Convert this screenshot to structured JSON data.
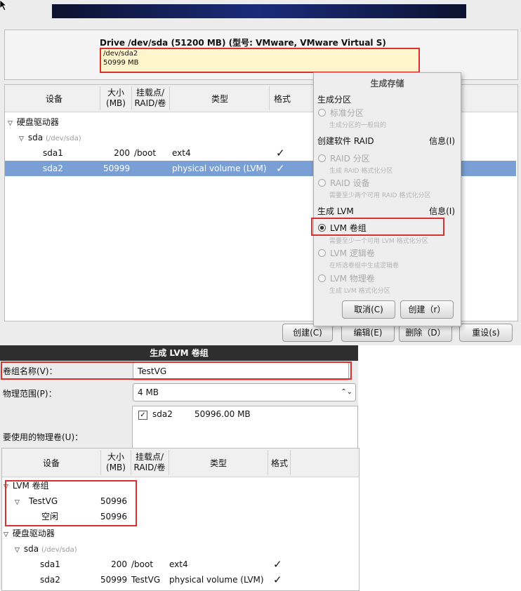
{
  "drive": {
    "title": "Drive /dev/sda (51200 MB) (型号: VMware, VMware Virtual S)",
    "bar_line1": "/dev/sda2",
    "bar_line2": "50999 MB"
  },
  "table_top": {
    "headers": {
      "device": "设备",
      "size": "大小\n(MB)",
      "mount": "挂载点/\nRAID/卷",
      "type": "类型",
      "format": "格式"
    },
    "hard_drives": "硬盘驱动器",
    "sda": "sda",
    "sda_path": "(/dev/sda)",
    "rows": [
      {
        "device": "sda1",
        "size": "200",
        "mount": "/boot",
        "type": "ext4",
        "format": "✓"
      },
      {
        "device": "sda2",
        "size": "50999",
        "mount": "",
        "type": "physical volume (LVM)",
        "format": "✓"
      }
    ]
  },
  "buttons": {
    "create": "创建(C)",
    "edit": "编辑(E)",
    "delete": "删除（D）",
    "reset": "重设(s)"
  },
  "dialog": {
    "title": "生成存储",
    "section_partition": "生成分区",
    "std_partition": "标准分区",
    "std_partition_desc": "生成分区的一般目的",
    "section_raid": "创建软件 RAID",
    "info1": "信息(I)",
    "raid_partition": "RAID 分区",
    "raid_partition_desc": "生成 RAID 格式化分区",
    "raid_device": "RAID 设备",
    "raid_device_desc": "需要至少两个可用 RAID 格式化分区",
    "section_lvm": "生成 LVM",
    "info2": "信息(I)",
    "lvm_vg": "LVM 卷组",
    "lvm_vg_desc": "需要至少一个可用 LVM 格式化分区",
    "lvm_lv": "LVM 逻辑卷",
    "lvm_lv_desc": "在所选卷组中生成逻辑卷",
    "lvm_pv": "LVM 物理卷",
    "lvm_pv_desc": "生成 LVM 格式化分区",
    "cancel": "取消(C)",
    "create": "创建（r）"
  },
  "lvm_dialog": {
    "title": "生成 LVM 卷组",
    "vg_name_label": "卷组名称(V)：",
    "vg_name_value": "TestVG",
    "extent_label": "物理范围(P)：",
    "extent_value": "4 MB",
    "pv_label": "要使用的物理卷(U)：",
    "pv_item_name": "sda2",
    "pv_item_size": "50996.00 MB",
    "pv_checked": true
  },
  "table_bottom": {
    "headers": {
      "device": "设备",
      "size": "大小\n(MB)",
      "mount": "挂载点/\nRAID/卷",
      "type": "类型",
      "format": "格式"
    },
    "lvm_group": "LVM 卷组",
    "testvg": "TestVG",
    "testvg_size": "50996",
    "free": "空闲",
    "free_size": "50996",
    "hard_drives": "硬盘驱动器",
    "sda": "sda",
    "sda_path": "(/dev/sda)",
    "rows": [
      {
        "device": "sda1",
        "size": "200",
        "mount": "/boot",
        "type": "ext4",
        "format": "✓"
      },
      {
        "device": "sda2",
        "size": "50999",
        "mount": "TestVG",
        "type": "physical volume (LVM)",
        "format": "✓"
      }
    ]
  },
  "colors": {
    "selection": "#7a9fd4",
    "highlight_red": "#d93030",
    "banner": "#1b2b7a"
  }
}
